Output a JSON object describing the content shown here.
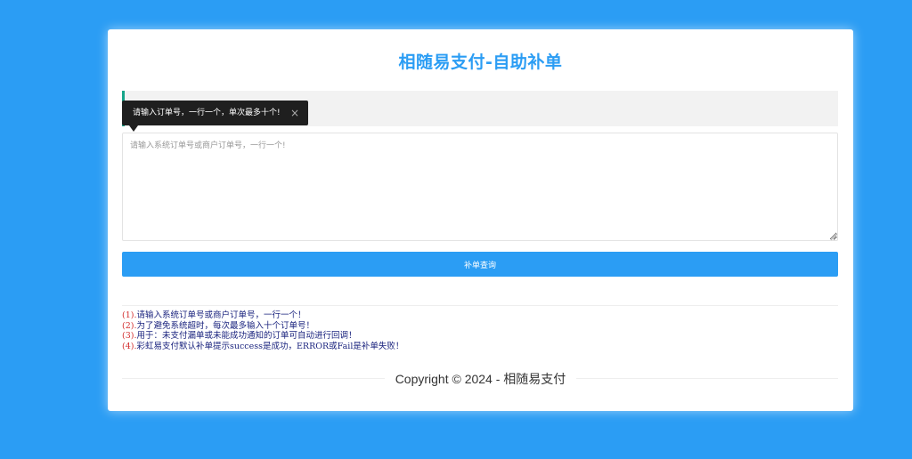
{
  "page": {
    "title": "相随易支付-自助补单"
  },
  "tooltip": {
    "text": "请输入订单号，一行一个，单次最多十个!",
    "close": "×"
  },
  "order_input": {
    "placeholder": "请输入系统订单号或商户订单号，一行一个!",
    "value": ""
  },
  "submit_button": {
    "label": "补单查询"
  },
  "notes": [
    {
      "num": "(1).",
      "text": "请输入系统订单号或商户订单号，一行一个！"
    },
    {
      "num": "(2).",
      "text": "为了避免系统超时，每次最多输入十个订单号！"
    },
    {
      "num": "(3).",
      "text": "用于：未支付漏单或未能成功通知的订单可自动进行回调！"
    },
    {
      "num": "(4).",
      "text": "彩虹易支付默认补单提示success是成功，ERROR或Fail是补单失败！"
    }
  ],
  "footer": {
    "copyright": "Copyright © 2024 - 相随易支付"
  },
  "colors": {
    "background": "#2b9df4",
    "accent": "#2b9df4",
    "note_number": "#d32f2f",
    "note_text": "#1a237e"
  }
}
